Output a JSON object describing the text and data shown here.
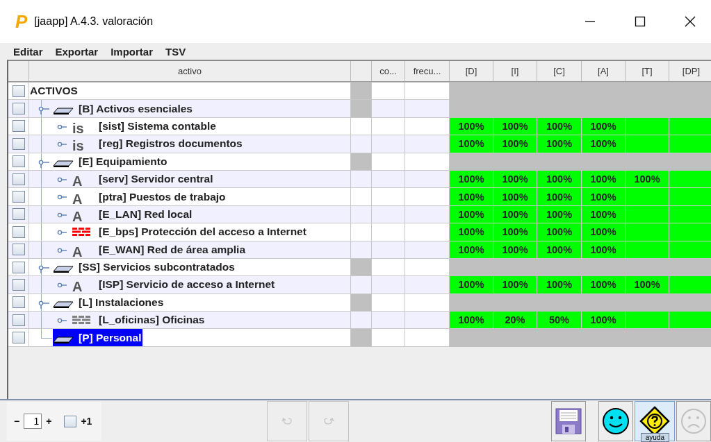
{
  "window": {
    "logo": "P",
    "title": "[jaapp] A.4.3. valoración"
  },
  "menu": [
    "Editar",
    "Exportar",
    "Importar",
    "TSV"
  ],
  "columns": [
    {
      "label": "activo"
    },
    {},
    {
      "label": "co..."
    },
    {
      "label": "frecu..."
    },
    {
      "label": "[D]"
    },
    {
      "label": "[I]"
    },
    {
      "label": "[C]"
    },
    {
      "label": "[A]"
    },
    {
      "label": "[T]"
    },
    {
      "label": "[DP]"
    }
  ],
  "tree": {
    "label": "ACTIVOS",
    "checked": false,
    "selected": false,
    "children": [
      {
        "label": "[B] Activos esenciales",
        "checked": false,
        "selected": false,
        "children": [
          {
            "label": "[sist] Sistema contable",
            "checked": false,
            "selected": false,
            "icon": {
              "kind": "letters",
              "glyph": "is"
            },
            "values": [
              "100%",
              "100%",
              "100%",
              "100%"
            ]
          },
          {
            "label": "[reg] Registros documentos",
            "checked": false,
            "selected": false,
            "icon": {
              "kind": "letters",
              "glyph": "is"
            },
            "values": [
              "100%",
              "100%",
              "100%",
              "100%"
            ]
          }
        ]
      },
      {
        "label": "[E] Equipamiento",
        "checked": false,
        "selected": false,
        "children": [
          {
            "label": "[serv] Servidor central",
            "checked": false,
            "selected": false,
            "icon": {
              "kind": "letters",
              "glyph": "A"
            },
            "values": [
              "100%",
              "100%",
              "100%",
              "100%",
              "100%"
            ]
          },
          {
            "label": "[ptra] Puestos de trabajo",
            "checked": false,
            "selected": false,
            "icon": {
              "kind": "letters",
              "glyph": "A"
            },
            "values": [
              "100%",
              "100%",
              "100%",
              "100%"
            ]
          },
          {
            "label": "[E_LAN] Red local",
            "checked": false,
            "selected": false,
            "icon": {
              "kind": "letters",
              "glyph": "A"
            },
            "values": [
              "100%",
              "100%",
              "100%",
              "100%"
            ]
          },
          {
            "label": "[E_bps] Protección del acceso a Internet",
            "checked": false,
            "selected": false,
            "icon": {
              "kind": "bricks",
              "color": "#ff0000"
            },
            "values": [
              "100%",
              "100%",
              "100%",
              "100%"
            ]
          },
          {
            "label": "[E_WAN] Red de área amplia",
            "checked": false,
            "selected": false,
            "icon": {
              "kind": "letters",
              "glyph": "A"
            },
            "values": [
              "100%",
              "100%",
              "100%",
              "100%"
            ]
          }
        ]
      },
      {
        "label": "[SS] Servicios subcontratados",
        "checked": false,
        "selected": false,
        "children": [
          {
            "label": "[ISP] Servicio de acceso a Internet",
            "checked": false,
            "selected": false,
            "icon": {
              "kind": "letters",
              "glyph": "A"
            },
            "values": [
              "100%",
              "100%",
              "100%",
              "100%",
              "100%"
            ]
          }
        ]
      },
      {
        "label": "[L] Instalaciones",
        "checked": false,
        "selected": false,
        "children": [
          {
            "label": "[L_oficinas] Oficinas",
            "checked": false,
            "selected": false,
            "icon": {
              "kind": "bricks",
              "color": "#808080"
            },
            "values": [
              "100%",
              "20%",
              "50%",
              "100%"
            ]
          }
        ]
      },
      {
        "label": "[P] Personal",
        "checked": false,
        "selected": true
      }
    ]
  },
  "footer": {
    "minus": "−",
    "count": "1",
    "plus": "+",
    "step_checked": false,
    "step_label": "+1",
    "undo_disabled": true,
    "redo_disabled": true,
    "sad_disabled": true,
    "tooltip": "ayuda"
  }
}
